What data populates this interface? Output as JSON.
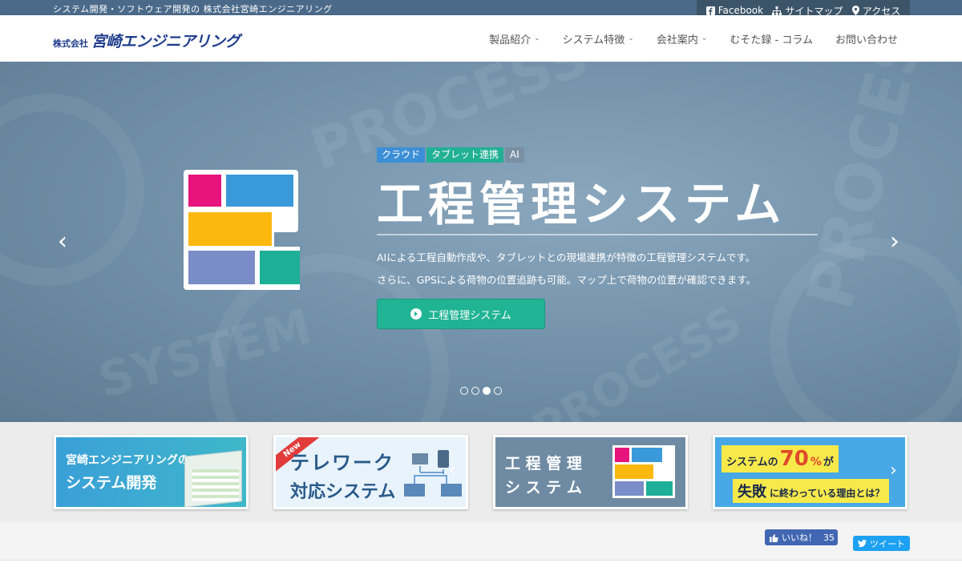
{
  "topbar": {
    "tagline": "システム開発・ソフトウェア開発の 株式会社宮崎エンジニアリング"
  },
  "toplinks": [
    {
      "label": "Facebook",
      "icon": "facebook-icon"
    },
    {
      "label": "サイトマップ",
      "icon": "sitemap-icon"
    },
    {
      "label": "アクセス",
      "icon": "map-marker-icon"
    }
  ],
  "logo": {
    "small": "株式会社",
    "big": "宮崎エンジニアリング"
  },
  "nav": [
    {
      "label": "製品紹介",
      "dropdown": true
    },
    {
      "label": "システム特徴",
      "dropdown": true
    },
    {
      "label": "会社案内",
      "dropdown": true
    },
    {
      "label": "むそた録 - コラム",
      "dropdown": false
    },
    {
      "label": "お問い合わせ",
      "dropdown": false
    }
  ],
  "hero": {
    "tags": [
      {
        "label": "クラウド",
        "color": "#3c8fd6"
      },
      {
        "label": "タブレット連携",
        "color": "#21b094"
      },
      {
        "label": "AI",
        "color": "#7a8fa3"
      }
    ],
    "title": "工程管理システム",
    "desc1": "AIによる工程自動作成や、タブレットとの現場連携が特徴の工程管理システムです。",
    "desc2": "さらに、GPSによる荷物の位置追跡も可能。マップ上で荷物の位置が確認できます。",
    "button": "工程管理システム",
    "prev": "‹",
    "next": "›",
    "slides": 4,
    "active_slide": 3
  },
  "banners": {
    "b1_line1": "宮崎エンジニアリングの",
    "b1_line2": "システム開発",
    "b2_badge": "New",
    "b2_line1": "テレワーク",
    "b2_line2": "対応システム",
    "b3_line1": "工 程 管 理",
    "b3_line2": "シ ス テ ム",
    "b4_line1a": "システムの",
    "b4_big": "70",
    "b4_pct": "%",
    "b4_ga": "が",
    "b4_line2a": "失敗",
    "b4_line2b": "に終わっている理由とは？",
    "arrow_left": "‹",
    "arrow_right": "›"
  },
  "social": {
    "like": "いいね！",
    "like_count": "35",
    "tweet": "ツイート"
  },
  "colors": {
    "pink": "#e6147c",
    "blue": "#3a9ad9",
    "yellow": "#fbb80f",
    "violet": "#7b8dc8",
    "teal": "#1eaf98"
  }
}
